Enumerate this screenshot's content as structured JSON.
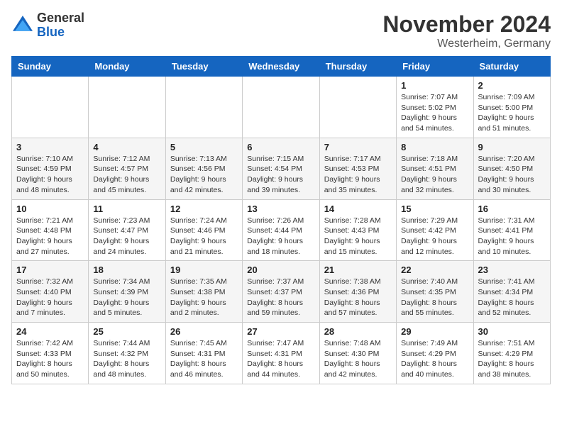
{
  "logo": {
    "general": "General",
    "blue": "Blue"
  },
  "header": {
    "month": "November 2024",
    "location": "Westerheim, Germany"
  },
  "weekdays": [
    "Sunday",
    "Monday",
    "Tuesday",
    "Wednesday",
    "Thursday",
    "Friday",
    "Saturday"
  ],
  "weeks": [
    [
      {
        "day": "",
        "info": ""
      },
      {
        "day": "",
        "info": ""
      },
      {
        "day": "",
        "info": ""
      },
      {
        "day": "",
        "info": ""
      },
      {
        "day": "",
        "info": ""
      },
      {
        "day": "1",
        "info": "Sunrise: 7:07 AM\nSunset: 5:02 PM\nDaylight: 9 hours and 54 minutes."
      },
      {
        "day": "2",
        "info": "Sunrise: 7:09 AM\nSunset: 5:00 PM\nDaylight: 9 hours and 51 minutes."
      }
    ],
    [
      {
        "day": "3",
        "info": "Sunrise: 7:10 AM\nSunset: 4:59 PM\nDaylight: 9 hours and 48 minutes."
      },
      {
        "day": "4",
        "info": "Sunrise: 7:12 AM\nSunset: 4:57 PM\nDaylight: 9 hours and 45 minutes."
      },
      {
        "day": "5",
        "info": "Sunrise: 7:13 AM\nSunset: 4:56 PM\nDaylight: 9 hours and 42 minutes."
      },
      {
        "day": "6",
        "info": "Sunrise: 7:15 AM\nSunset: 4:54 PM\nDaylight: 9 hours and 39 minutes."
      },
      {
        "day": "7",
        "info": "Sunrise: 7:17 AM\nSunset: 4:53 PM\nDaylight: 9 hours and 35 minutes."
      },
      {
        "day": "8",
        "info": "Sunrise: 7:18 AM\nSunset: 4:51 PM\nDaylight: 9 hours and 32 minutes."
      },
      {
        "day": "9",
        "info": "Sunrise: 7:20 AM\nSunset: 4:50 PM\nDaylight: 9 hours and 30 minutes."
      }
    ],
    [
      {
        "day": "10",
        "info": "Sunrise: 7:21 AM\nSunset: 4:48 PM\nDaylight: 9 hours and 27 minutes."
      },
      {
        "day": "11",
        "info": "Sunrise: 7:23 AM\nSunset: 4:47 PM\nDaylight: 9 hours and 24 minutes."
      },
      {
        "day": "12",
        "info": "Sunrise: 7:24 AM\nSunset: 4:46 PM\nDaylight: 9 hours and 21 minutes."
      },
      {
        "day": "13",
        "info": "Sunrise: 7:26 AM\nSunset: 4:44 PM\nDaylight: 9 hours and 18 minutes."
      },
      {
        "day": "14",
        "info": "Sunrise: 7:28 AM\nSunset: 4:43 PM\nDaylight: 9 hours and 15 minutes."
      },
      {
        "day": "15",
        "info": "Sunrise: 7:29 AM\nSunset: 4:42 PM\nDaylight: 9 hours and 12 minutes."
      },
      {
        "day": "16",
        "info": "Sunrise: 7:31 AM\nSunset: 4:41 PM\nDaylight: 9 hours and 10 minutes."
      }
    ],
    [
      {
        "day": "17",
        "info": "Sunrise: 7:32 AM\nSunset: 4:40 PM\nDaylight: 9 hours and 7 minutes."
      },
      {
        "day": "18",
        "info": "Sunrise: 7:34 AM\nSunset: 4:39 PM\nDaylight: 9 hours and 5 minutes."
      },
      {
        "day": "19",
        "info": "Sunrise: 7:35 AM\nSunset: 4:38 PM\nDaylight: 9 hours and 2 minutes."
      },
      {
        "day": "20",
        "info": "Sunrise: 7:37 AM\nSunset: 4:37 PM\nDaylight: 8 hours and 59 minutes."
      },
      {
        "day": "21",
        "info": "Sunrise: 7:38 AM\nSunset: 4:36 PM\nDaylight: 8 hours and 57 minutes."
      },
      {
        "day": "22",
        "info": "Sunrise: 7:40 AM\nSunset: 4:35 PM\nDaylight: 8 hours and 55 minutes."
      },
      {
        "day": "23",
        "info": "Sunrise: 7:41 AM\nSunset: 4:34 PM\nDaylight: 8 hours and 52 minutes."
      }
    ],
    [
      {
        "day": "24",
        "info": "Sunrise: 7:42 AM\nSunset: 4:33 PM\nDaylight: 8 hours and 50 minutes."
      },
      {
        "day": "25",
        "info": "Sunrise: 7:44 AM\nSunset: 4:32 PM\nDaylight: 8 hours and 48 minutes."
      },
      {
        "day": "26",
        "info": "Sunrise: 7:45 AM\nSunset: 4:31 PM\nDaylight: 8 hours and 46 minutes."
      },
      {
        "day": "27",
        "info": "Sunrise: 7:47 AM\nSunset: 4:31 PM\nDaylight: 8 hours and 44 minutes."
      },
      {
        "day": "28",
        "info": "Sunrise: 7:48 AM\nSunset: 4:30 PM\nDaylight: 8 hours and 42 minutes."
      },
      {
        "day": "29",
        "info": "Sunrise: 7:49 AM\nSunset: 4:29 PM\nDaylight: 8 hours and 40 minutes."
      },
      {
        "day": "30",
        "info": "Sunrise: 7:51 AM\nSunset: 4:29 PM\nDaylight: 8 hours and 38 minutes."
      }
    ]
  ]
}
